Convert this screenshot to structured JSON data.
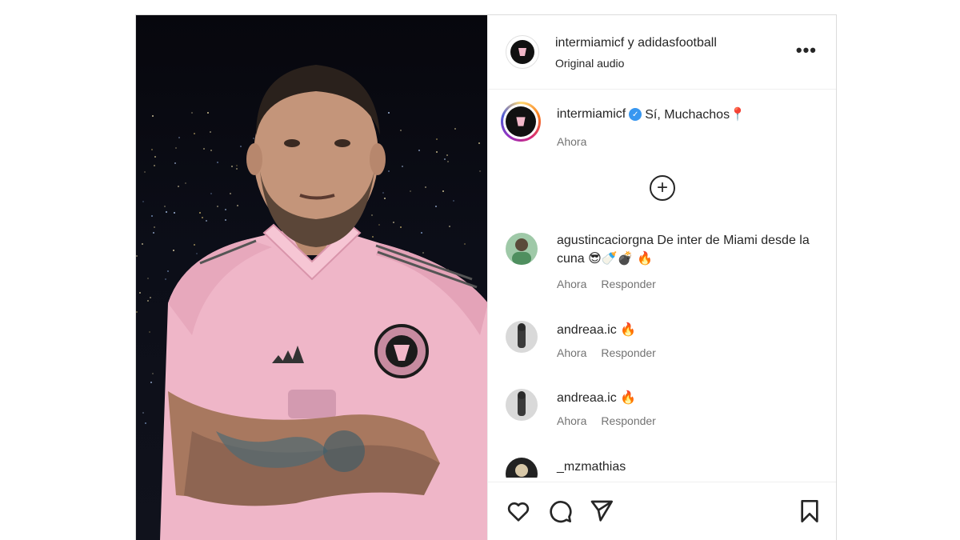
{
  "header": {
    "title": "intermiamicf y adidasfootball",
    "subtitle": "Original audio",
    "more_label": "•••"
  },
  "caption": {
    "username": "intermiamicf",
    "text": "Sí, Muchachos📍",
    "time": "Ahora"
  },
  "comments": [
    {
      "username": "agustincaciorgna",
      "text": "De inter de Miami desde la cuna 😎🍼💣 🔥",
      "time": "Ahora",
      "reply": "Responder"
    },
    {
      "username": "andreaa.ic",
      "text": "🔥",
      "time": "Ahora",
      "reply": "Responder"
    },
    {
      "username": "andreaa.ic",
      "text": "🔥",
      "time": "Ahora",
      "reply": "Responder"
    },
    {
      "username": "_mzmathias",
      "text": "",
      "time": "",
      "reply": ""
    }
  ],
  "icons": {
    "load_more": "plus-circle-icon",
    "like": "heart-icon",
    "comment": "comment-icon",
    "share": "share-icon",
    "save": "bookmark-icon",
    "verified": "verified-badge-icon"
  },
  "colors": {
    "jersey_pink": "#f2b8c9",
    "verified_blue": "#3897f0",
    "muted_text": "#737373"
  }
}
